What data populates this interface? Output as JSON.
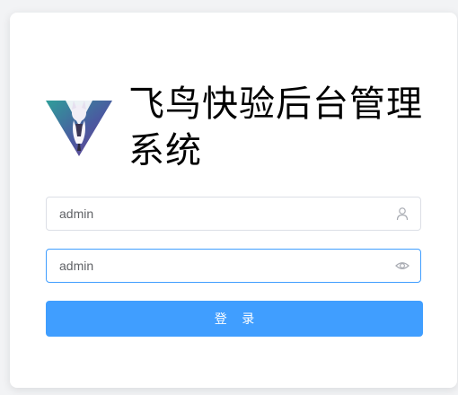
{
  "app": {
    "title": "飞鸟快验后台管理系统"
  },
  "form": {
    "username": {
      "value": "admin",
      "icon": "user-icon"
    },
    "password": {
      "value": "admin",
      "icon": "eye-icon"
    },
    "login_label": "登 录"
  },
  "colors": {
    "primary": "#409eff",
    "border": "#dcdfe6",
    "text": "#606266"
  }
}
